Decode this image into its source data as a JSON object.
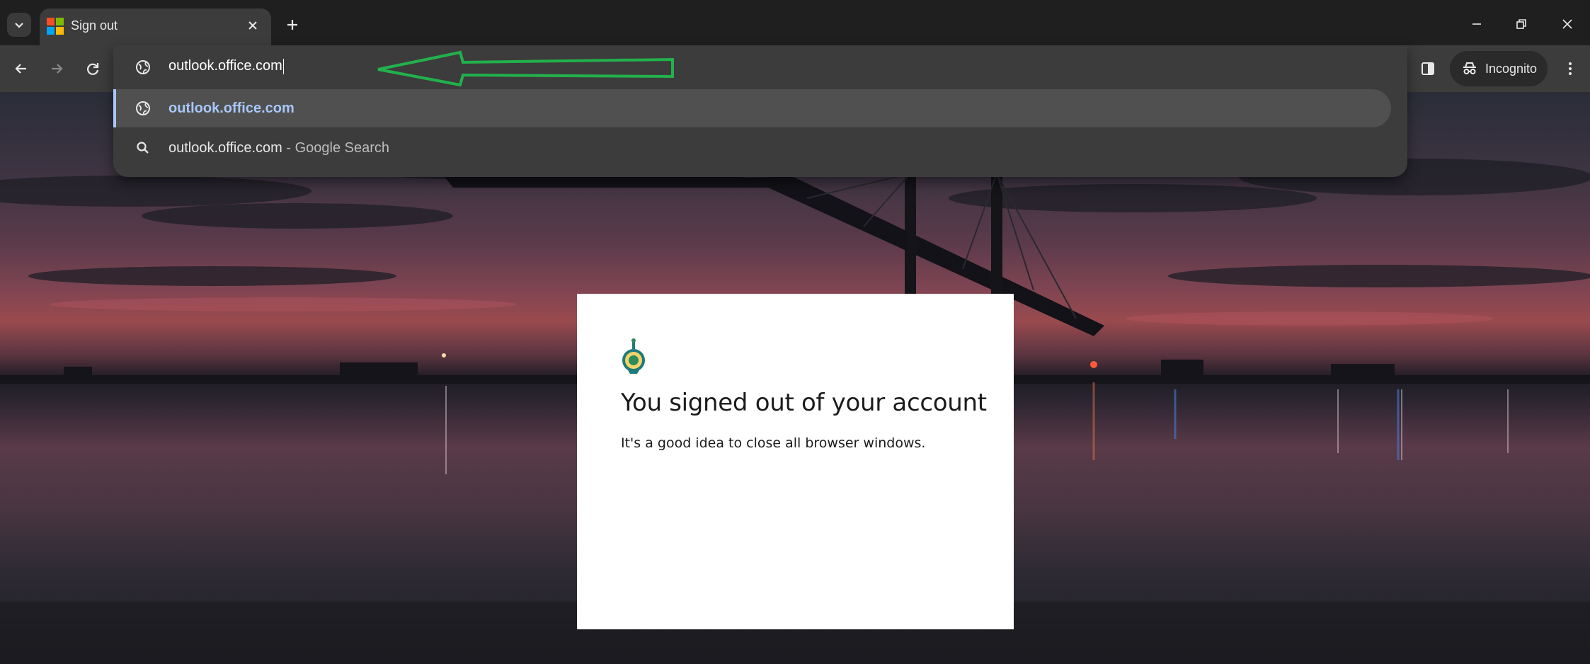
{
  "browser": {
    "tab": {
      "title": "Sign out",
      "favicon": "microsoft-logo-icon"
    },
    "address_bar": {
      "value": "outlook.office.com"
    },
    "suggestions": [
      {
        "icon": "globe-icon",
        "text": "outlook.office.com",
        "suffix": ""
      },
      {
        "icon": "search-icon",
        "text": "outlook.office.com",
        "suffix": " - Google Search"
      }
    ],
    "profile": {
      "label": "Incognito",
      "icon": "incognito-icon"
    },
    "annotation_arrow": {
      "color": "#22b14c",
      "icon": "left-arrow-annotation"
    }
  },
  "colors": {
    "tabstrip": "#1f1f1f",
    "toolbar": "#3c3c3c",
    "suggestion_highlight": "#a8c7fa"
  },
  "page": {
    "title": "You signed out of your account",
    "message": "It's a good idea to close all browser windows."
  }
}
